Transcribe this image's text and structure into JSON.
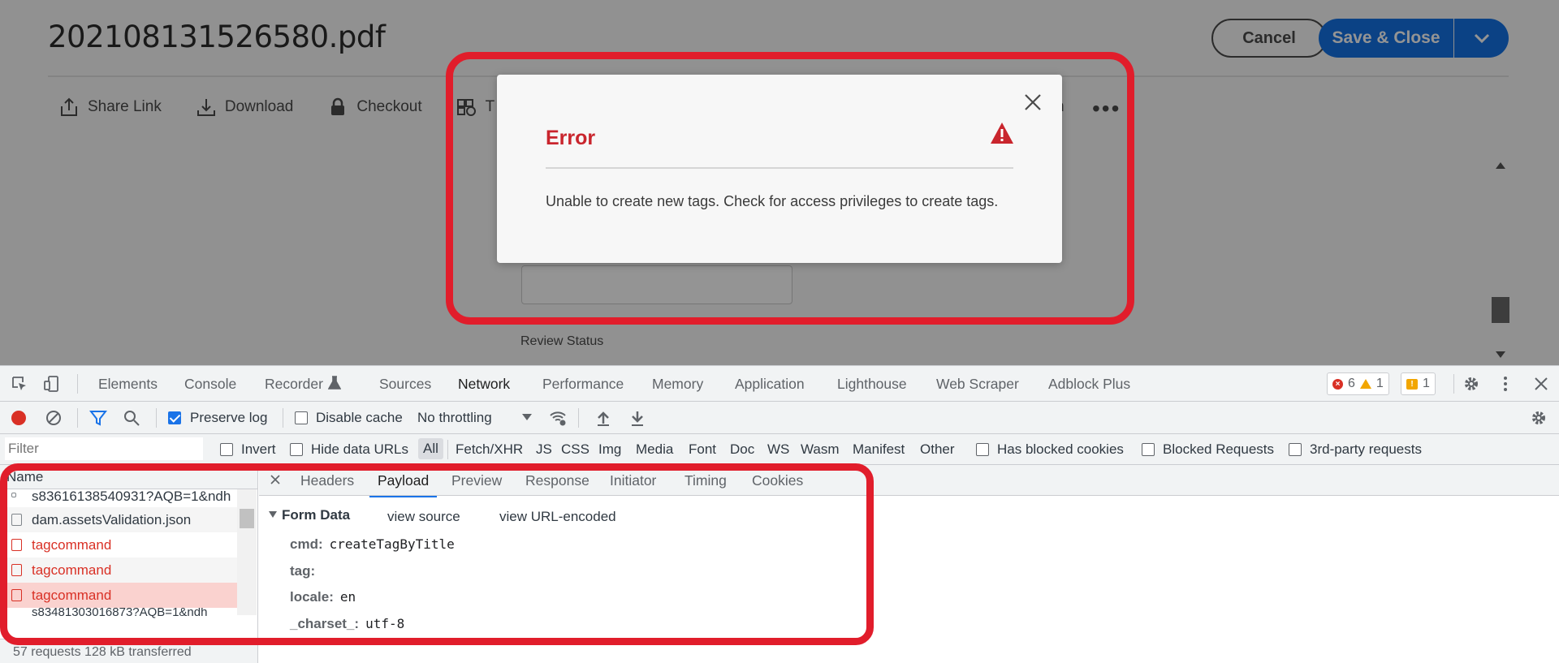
{
  "app": {
    "file_title": "202108131526580.pdf",
    "cancel_label": "Cancel",
    "save_close_label": "Save & Close",
    "toolbar": [
      {
        "label": "Share Link",
        "icon": "share-icon"
      },
      {
        "label": "Download",
        "icon": "download-icon"
      },
      {
        "label": "Checkout",
        "icon": "lock-icon"
      },
      {
        "label": "T",
        "icon": "add-tag-icon"
      }
    ],
    "toolbar_fragment": "n",
    "more_label": "•••",
    "review_status_label": "Review Status"
  },
  "dialog": {
    "title": "Error",
    "message": "Unable to create new tags. Check for access privileges to create tags."
  },
  "devtools": {
    "tabs": [
      "Elements",
      "Console",
      "Recorder",
      "Sources",
      "Network",
      "Performance",
      "Memory",
      "Application",
      "Lighthouse",
      "Web Scraper",
      "Adblock Plus"
    ],
    "active_tab": "Network",
    "errors_count": "6",
    "warnings_count": "1",
    "issues_count": "1",
    "preserve_log_label": "Preserve log",
    "disable_cache_label": "Disable cache",
    "throttling_label": "No throttling",
    "filter_placeholder": "Filter",
    "invert_label": "Invert",
    "hide_data_urls_label": "Hide data URLs",
    "type_filters": [
      "All",
      "Fetch/XHR",
      "JS",
      "CSS",
      "Img",
      "Media",
      "Font",
      "Doc",
      "WS",
      "Wasm",
      "Manifest",
      "Other"
    ],
    "has_blocked_cookies_label": "Has blocked cookies",
    "blocked_requests_label": "Blocked Requests",
    "third_party_label": "3rd-party requests",
    "name_header": "Name",
    "requests": [
      {
        "name": "s83616138540931?AQB=1&ndh",
        "error": false
      },
      {
        "name": "dam.assetsValidation.json",
        "error": false
      },
      {
        "name": "tagcommand",
        "error": true
      },
      {
        "name": "tagcommand",
        "error": true
      },
      {
        "name": "tagcommand",
        "error": true
      },
      {
        "name": "s83481303016873?AQB=1&ndh",
        "error": false
      }
    ],
    "status_bar": "57 requests   128 kB transferred",
    "detail_tabs": [
      "Headers",
      "Payload",
      "Preview",
      "Response",
      "Initiator",
      "Timing",
      "Cookies"
    ],
    "active_detail_tab": "Payload",
    "form_data_label": "Form Data",
    "view_source_label": "view source",
    "view_url_encoded_label": "view URL-encoded",
    "form_data": [
      {
        "key": "cmd:",
        "value": "createTagByTitle"
      },
      {
        "key": "tag:",
        "value": ""
      },
      {
        "key": "locale:",
        "value": "en"
      },
      {
        "key": "_charset_:",
        "value": "utf-8"
      }
    ]
  },
  "colors": {
    "accent_blue": "#1473e6",
    "error_red": "#c9252d",
    "highlight_red": "#e11d2b",
    "devtools_blue": "#1a73e8"
  }
}
